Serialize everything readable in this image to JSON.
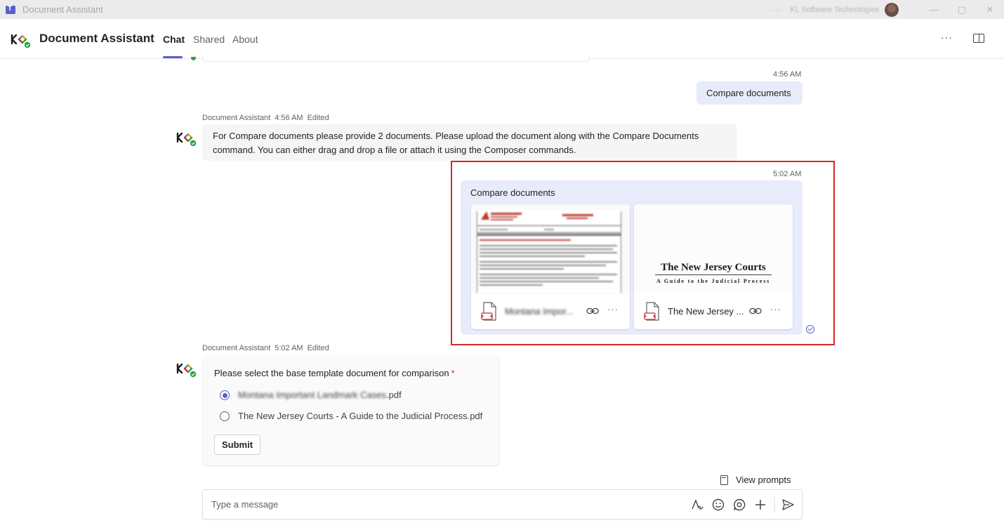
{
  "window": {
    "title": "Document Assistant",
    "org_name": "KL Software Technologies"
  },
  "header": {
    "app_name": "Document Assistant",
    "tabs": [
      {
        "label": "Chat"
      },
      {
        "label": "Shared"
      },
      {
        "label": "About"
      }
    ]
  },
  "messages": {
    "user1": {
      "time": "4:56 AM",
      "text": "Compare documents"
    },
    "bot1": {
      "sender": "Document Assistant",
      "time": "4:56 AM",
      "edited": "Edited",
      "line1": "For Compare documents please provide 2 documents. Please upload the document along with the Compare Documents",
      "line2": "command. You can either drag and drop a file or attach it using the Composer commands."
    },
    "user2": {
      "time": "5:02 AM",
      "text": "Compare documents",
      "files": [
        {
          "name": "Montana Impor..."
        },
        {
          "name": "The New Jersey ...",
          "preview_title": "The New Jersey Courts",
          "preview_subtitle": "A Guide to the Judicial Process"
        }
      ]
    },
    "bot2": {
      "sender": "Document Assistant",
      "time": "5:02 AM",
      "edited": "Edited",
      "prompt": "Please select the base template document for comparison",
      "required_mark": "*",
      "options": [
        {
          "name_part": "Montana Important Landmark Cases",
          "ext": ".pdf",
          "selected": true
        },
        {
          "label": "The New Jersey Courts - A Guide to the Judicial Process.pdf",
          "selected": false
        }
      ],
      "submit_label": "Submit"
    }
  },
  "composer": {
    "placeholder": "Type a message",
    "view_prompts": "View prompts"
  },
  "colors": {
    "accent": "#5b5fc7",
    "highlight_border": "#d62828",
    "user_bubble": "#e8ebfa",
    "bot_bubble": "#f5f5f5",
    "presence": "#2ea043"
  }
}
